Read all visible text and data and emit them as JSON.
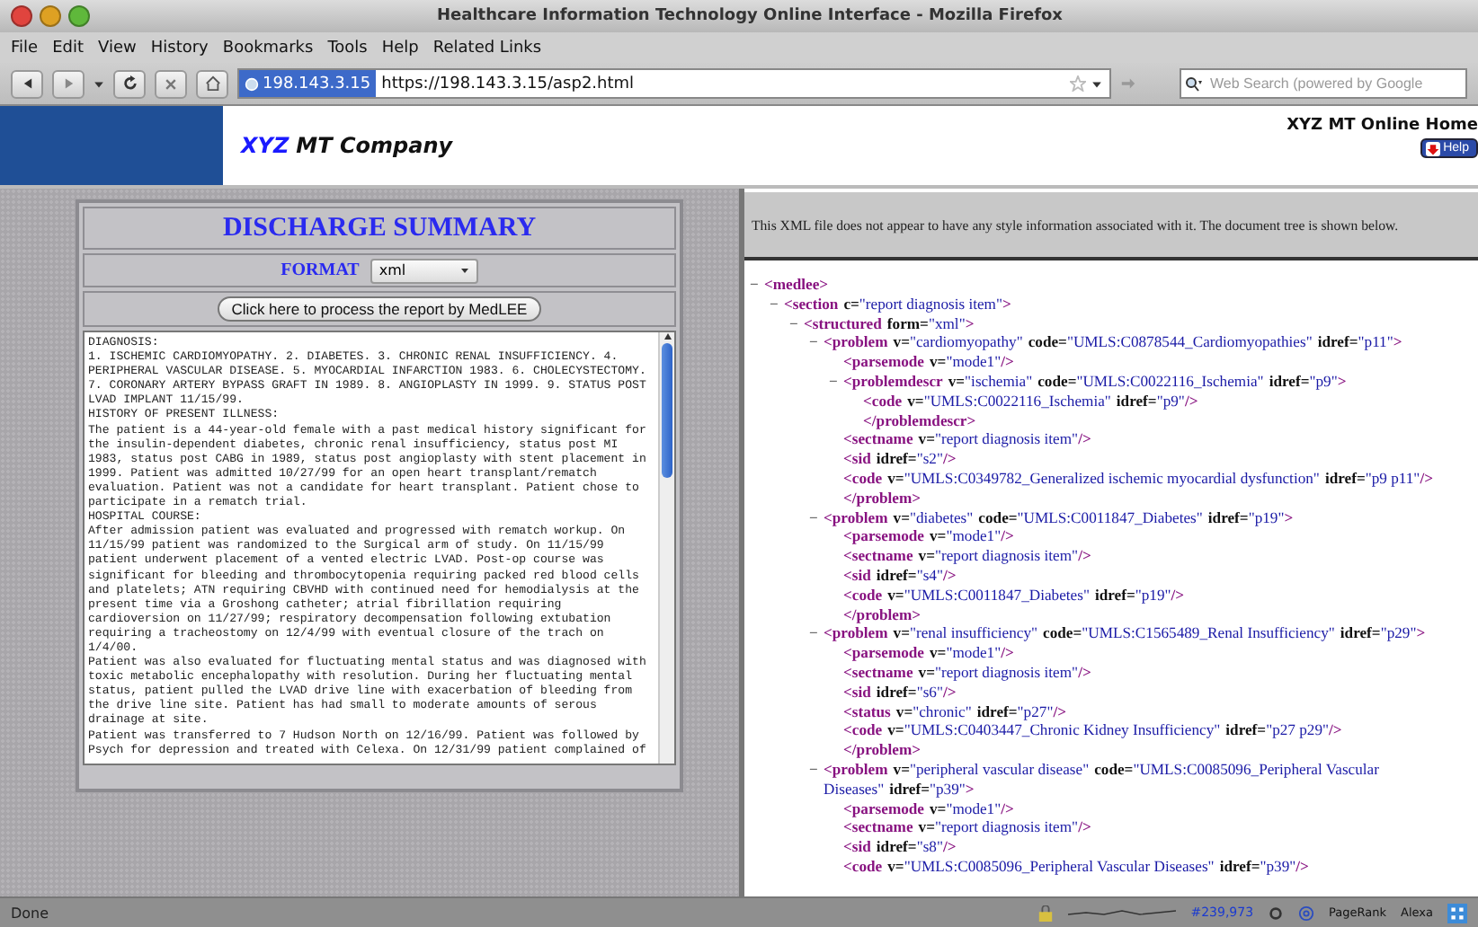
{
  "window": {
    "title": "Healthcare Information Technology Online Interface - Mozilla Firefox"
  },
  "menu": [
    "File",
    "Edit",
    "View",
    "History",
    "Bookmarks",
    "Tools",
    "Help",
    "Related Links"
  ],
  "address_bar": {
    "site_identity": "198.143.3.15",
    "url": "https://198.143.3.15/asp2.html"
  },
  "search": {
    "placeholder": "Web Search (powered by Google"
  },
  "header": {
    "logo_accent": "XYZ",
    "logo_rest": "MT Company",
    "home_link": "XYZ MT Online Home",
    "help_button": "Help"
  },
  "form": {
    "title": "DISCHARGE SUMMARY",
    "format_label": "FORMAT",
    "format_value": "xml",
    "process_button": "Click here to process the report by MedLEE",
    "report_lines": [
      "DIAGNOSIS:",
      "1. ISCHEMIC CARDIOMYOPATHY. 2. DIABETES. 3. CHRONIC RENAL INSUFFICIENCY. 4.",
      "PERIPHERAL VASCULAR DISEASE. 5. MYOCARDIAL INFARCTION 1983. 6. CHOLECYSTECTOMY.",
      "7. CORONARY ARTERY BYPASS GRAFT IN 1989. 8. ANGIOPLASTY IN 1999. 9. STATUS POST",
      "LVAD IMPLANT 11/15/99.",
      "HISTORY OF PRESENT ILLNESS:",
      "The patient is a 44-year-old female with a past medical history significant for",
      "the insulin-dependent diabetes, chronic renal insufficiency, status post MI",
      "1983, status post CABG in 1989, status post angioplasty with stent placement in",
      "1999. Patient was admitted 10/27/99 for an open heart transplant/rematch",
      "evaluation. Patient was not a candidate for heart transplant. Patient chose to",
      "participate in a rematch trial.",
      "HOSPITAL COURSE:",
      "After admission patient was evaluated and progressed with rematch workup. On",
      "11/15/99 patient was randomized to the Surgical arm of study. On 11/15/99",
      "patient underwent placement of a vented electric LVAD. Post-op course was",
      "significant for bleeding and thrombocytopenia requiring packed red blood cells",
      "and platelets; ATN requiring CBVHD with continued need for hemodialysis at the",
      "present time via a Groshong catheter; atrial fibrillation requiring",
      "cardioversion on 11/27/99; respiratory decompensation following extubation",
      "requiring a tracheostomy on 12/4/99 with eventual closure of the trach on",
      "1/4/00.",
      "Patient was also evaluated for fluctuating mental status and was diagnosed with",
      "toxic metabolic encephalopathy with resolution. During her fluctuating mental",
      "status, patient pulled the LVAD drive line with exacerbation of bleeding from",
      "the drive line site. Patient has had small to moderate amounts of serous",
      "drainage at site.",
      "Patient was transferred to 7 Hudson North on 12/16/99. Patient was followed by",
      "Psych for depression and treated with Celexa. On 12/31/99 patient complained of"
    ]
  },
  "xml_view": {
    "notice": "This XML file does not appear to have any style information associated with it. The document tree is shown below.",
    "tree": [
      {
        "toggle": "−",
        "expanded": true,
        "parts": [
          {
            "kind": "tag",
            "text": "<medlee>"
          }
        ],
        "children": [
          {
            "toggle": "−",
            "expanded": true,
            "parts": [
              {
                "kind": "tag",
                "text": "<section"
              },
              {
                "kind": "attr",
                "text": "c="
              },
              {
                "kind": "val",
                "text": "\"report diagnosis item\""
              },
              {
                "kind": "tag",
                "text": ">"
              }
            ],
            "children": [
              {
                "toggle": "−",
                "expanded": true,
                "parts": [
                  {
                    "kind": "tag",
                    "text": "<structured"
                  },
                  {
                    "kind": "attr",
                    "text": "form="
                  },
                  {
                    "kind": "val",
                    "text": "\"xml\""
                  },
                  {
                    "kind": "tag",
                    "text": ">"
                  }
                ],
                "children": [
                  {
                    "toggle": "−",
                    "expanded": true,
                    "parts": [
                      {
                        "kind": "tag",
                        "text": "<problem"
                      },
                      {
                        "kind": "attr",
                        "text": "v="
                      },
                      {
                        "kind": "val",
                        "text": "\"cardiomyopathy\""
                      },
                      {
                        "kind": "attr",
                        "text": "code="
                      },
                      {
                        "kind": "val",
                        "text": "\"UMLS:C0878544_Cardiomyopathies\""
                      },
                      {
                        "kind": "attr",
                        "text": "idref="
                      },
                      {
                        "kind": "val",
                        "text": "\"p11\""
                      },
                      {
                        "kind": "tag",
                        "text": ">"
                      }
                    ],
                    "end": "</problem>",
                    "children": [
                      {
                        "parts": [
                          {
                            "kind": "tag",
                            "text": "<parsemode"
                          },
                          {
                            "kind": "attr",
                            "text": "v="
                          },
                          {
                            "kind": "val",
                            "text": "\"mode1\""
                          },
                          {
                            "kind": "tag",
                            "text": "/>"
                          }
                        ]
                      },
                      {
                        "toggle": "−",
                        "expanded": true,
                        "parts": [
                          {
                            "kind": "tag",
                            "text": "<problemdescr"
                          },
                          {
                            "kind": "attr",
                            "text": "v="
                          },
                          {
                            "kind": "val",
                            "text": "\"ischemia\""
                          },
                          {
                            "kind": "attr",
                            "text": "code="
                          },
                          {
                            "kind": "val",
                            "text": "\"UMLS:C0022116_Ischemia\""
                          },
                          {
                            "kind": "attr",
                            "text": "idref="
                          },
                          {
                            "kind": "val",
                            "text": "\"p9\""
                          },
                          {
                            "kind": "tag",
                            "text": ">"
                          }
                        ],
                        "end": "</problemdescr>",
                        "children": [
                          {
                            "parts": [
                              {
                                "kind": "tag",
                                "text": "<code"
                              },
                              {
                                "kind": "attr",
                                "text": "v="
                              },
                              {
                                "kind": "val",
                                "text": "\"UMLS:C0022116_Ischemia\""
                              },
                              {
                                "kind": "attr",
                                "text": "idref="
                              },
                              {
                                "kind": "val",
                                "text": "\"p9\""
                              },
                              {
                                "kind": "tag",
                                "text": "/>"
                              }
                            ]
                          }
                        ]
                      },
                      {
                        "parts": [
                          {
                            "kind": "tag",
                            "text": "<sectname"
                          },
                          {
                            "kind": "attr",
                            "text": "v="
                          },
                          {
                            "kind": "val",
                            "text": "\"report diagnosis item\""
                          },
                          {
                            "kind": "tag",
                            "text": "/>"
                          }
                        ]
                      },
                      {
                        "parts": [
                          {
                            "kind": "tag",
                            "text": "<sid"
                          },
                          {
                            "kind": "attr",
                            "text": "idref="
                          },
                          {
                            "kind": "val",
                            "text": "\"s2\""
                          },
                          {
                            "kind": "tag",
                            "text": "/>"
                          }
                        ]
                      },
                      {
                        "parts": [
                          {
                            "kind": "tag",
                            "text": "<code"
                          },
                          {
                            "kind": "attr",
                            "text": "v="
                          },
                          {
                            "kind": "val",
                            "text": "\"UMLS:C0349782_Generalized ischemic myocardial dysfunction\""
                          },
                          {
                            "kind": "attr",
                            "text": "idref="
                          },
                          {
                            "kind": "val",
                            "text": "\"p9 p11\""
                          },
                          {
                            "kind": "tag",
                            "text": "/>"
                          }
                        ]
                      }
                    ]
                  },
                  {
                    "toggle": "−",
                    "expanded": true,
                    "parts": [
                      {
                        "kind": "tag",
                        "text": "<problem"
                      },
                      {
                        "kind": "attr",
                        "text": "v="
                      },
                      {
                        "kind": "val",
                        "text": "\"diabetes\""
                      },
                      {
                        "kind": "attr",
                        "text": "code="
                      },
                      {
                        "kind": "val",
                        "text": "\"UMLS:C0011847_Diabetes\""
                      },
                      {
                        "kind": "attr",
                        "text": "idref="
                      },
                      {
                        "kind": "val",
                        "text": "\"p19\""
                      },
                      {
                        "kind": "tag",
                        "text": ">"
                      }
                    ],
                    "end": "</problem>",
                    "children": [
                      {
                        "parts": [
                          {
                            "kind": "tag",
                            "text": "<parsemode"
                          },
                          {
                            "kind": "attr",
                            "text": "v="
                          },
                          {
                            "kind": "val",
                            "text": "\"mode1\""
                          },
                          {
                            "kind": "tag",
                            "text": "/>"
                          }
                        ]
                      },
                      {
                        "parts": [
                          {
                            "kind": "tag",
                            "text": "<sectname"
                          },
                          {
                            "kind": "attr",
                            "text": "v="
                          },
                          {
                            "kind": "val",
                            "text": "\"report diagnosis item\""
                          },
                          {
                            "kind": "tag",
                            "text": "/>"
                          }
                        ]
                      },
                      {
                        "parts": [
                          {
                            "kind": "tag",
                            "text": "<sid"
                          },
                          {
                            "kind": "attr",
                            "text": "idref="
                          },
                          {
                            "kind": "val",
                            "text": "\"s4\""
                          },
                          {
                            "kind": "tag",
                            "text": "/>"
                          }
                        ]
                      },
                      {
                        "parts": [
                          {
                            "kind": "tag",
                            "text": "<code"
                          },
                          {
                            "kind": "attr",
                            "text": "v="
                          },
                          {
                            "kind": "val",
                            "text": "\"UMLS:C0011847_Diabetes\""
                          },
                          {
                            "kind": "attr",
                            "text": "idref="
                          },
                          {
                            "kind": "val",
                            "text": "\"p19\""
                          },
                          {
                            "kind": "tag",
                            "text": "/>"
                          }
                        ]
                      }
                    ]
                  },
                  {
                    "toggle": "−",
                    "expanded": true,
                    "parts": [
                      {
                        "kind": "tag",
                        "text": "<problem"
                      },
                      {
                        "kind": "attr",
                        "text": "v="
                      },
                      {
                        "kind": "val",
                        "text": "\"renal insufficiency\""
                      },
                      {
                        "kind": "attr",
                        "text": "code="
                      },
                      {
                        "kind": "val",
                        "text": "\"UMLS:C1565489_Renal Insufficiency\""
                      },
                      {
                        "kind": "attr",
                        "text": "idref="
                      },
                      {
                        "kind": "val",
                        "text": "\"p29\""
                      },
                      {
                        "kind": "tag",
                        "text": ">"
                      }
                    ],
                    "end": "</problem>",
                    "children": [
                      {
                        "parts": [
                          {
                            "kind": "tag",
                            "text": "<parsemode"
                          },
                          {
                            "kind": "attr",
                            "text": "v="
                          },
                          {
                            "kind": "val",
                            "text": "\"mode1\""
                          },
                          {
                            "kind": "tag",
                            "text": "/>"
                          }
                        ]
                      },
                      {
                        "parts": [
                          {
                            "kind": "tag",
                            "text": "<sectname"
                          },
                          {
                            "kind": "attr",
                            "text": "v="
                          },
                          {
                            "kind": "val",
                            "text": "\"report diagnosis item\""
                          },
                          {
                            "kind": "tag",
                            "text": "/>"
                          }
                        ]
                      },
                      {
                        "parts": [
                          {
                            "kind": "tag",
                            "text": "<sid"
                          },
                          {
                            "kind": "attr",
                            "text": "idref="
                          },
                          {
                            "kind": "val",
                            "text": "\"s6\""
                          },
                          {
                            "kind": "tag",
                            "text": "/>"
                          }
                        ]
                      },
                      {
                        "parts": [
                          {
                            "kind": "tag",
                            "text": "<status"
                          },
                          {
                            "kind": "attr",
                            "text": "v="
                          },
                          {
                            "kind": "val",
                            "text": "\"chronic\""
                          },
                          {
                            "kind": "attr",
                            "text": "idref="
                          },
                          {
                            "kind": "val",
                            "text": "\"p27\""
                          },
                          {
                            "kind": "tag",
                            "text": "/>"
                          }
                        ]
                      },
                      {
                        "parts": [
                          {
                            "kind": "tag",
                            "text": "<code"
                          },
                          {
                            "kind": "attr",
                            "text": "v="
                          },
                          {
                            "kind": "val",
                            "text": "\"UMLS:C0403447_Chronic Kidney Insufficiency\""
                          },
                          {
                            "kind": "attr",
                            "text": "idref="
                          },
                          {
                            "kind": "val",
                            "text": "\"p27 p29\""
                          },
                          {
                            "kind": "tag",
                            "text": "/>"
                          }
                        ]
                      }
                    ]
                  },
                  {
                    "toggle": "−",
                    "expanded": true,
                    "parts": [
                      {
                        "kind": "tag",
                        "text": "<problem"
                      },
                      {
                        "kind": "attr",
                        "text": "v="
                      },
                      {
                        "kind": "val",
                        "text": "\"peripheral vascular disease\""
                      },
                      {
                        "kind": "attr",
                        "text": "code="
                      },
                      {
                        "kind": "val",
                        "text": "\"UMLS:C0085096_Peripheral Vascular Diseases\""
                      },
                      {
                        "kind": "attr",
                        "text": "idref="
                      },
                      {
                        "kind": "val",
                        "text": "\"p39\""
                      },
                      {
                        "kind": "tag",
                        "text": ">"
                      }
                    ],
                    "children": [
                      {
                        "parts": [
                          {
                            "kind": "tag",
                            "text": "<parsemode"
                          },
                          {
                            "kind": "attr",
                            "text": "v="
                          },
                          {
                            "kind": "val",
                            "text": "\"mode1\""
                          },
                          {
                            "kind": "tag",
                            "text": "/>"
                          }
                        ]
                      },
                      {
                        "parts": [
                          {
                            "kind": "tag",
                            "text": "<sectname"
                          },
                          {
                            "kind": "attr",
                            "text": "v="
                          },
                          {
                            "kind": "val",
                            "text": "\"report diagnosis item\""
                          },
                          {
                            "kind": "tag",
                            "text": "/>"
                          }
                        ]
                      },
                      {
                        "parts": [
                          {
                            "kind": "tag",
                            "text": "<sid"
                          },
                          {
                            "kind": "attr",
                            "text": "idref="
                          },
                          {
                            "kind": "val",
                            "text": "\"s8\""
                          },
                          {
                            "kind": "tag",
                            "text": "/>"
                          }
                        ]
                      },
                      {
                        "parts": [
                          {
                            "kind": "tag",
                            "text": "<code"
                          },
                          {
                            "kind": "attr",
                            "text": "v="
                          },
                          {
                            "kind": "val",
                            "text": "\"UMLS:C0085096_Peripheral Vascular Diseases\""
                          },
                          {
                            "kind": "attr",
                            "text": "idref="
                          },
                          {
                            "kind": "val",
                            "text": "\"p39\""
                          },
                          {
                            "kind": "tag",
                            "text": "/>"
                          }
                        ]
                      }
                    ]
                  }
                ]
              }
            ]
          }
        ]
      }
    ]
  },
  "status_bar": {
    "text": "Done",
    "rank": "#239,973",
    "items": [
      "PageRank",
      "Alexa"
    ]
  }
}
